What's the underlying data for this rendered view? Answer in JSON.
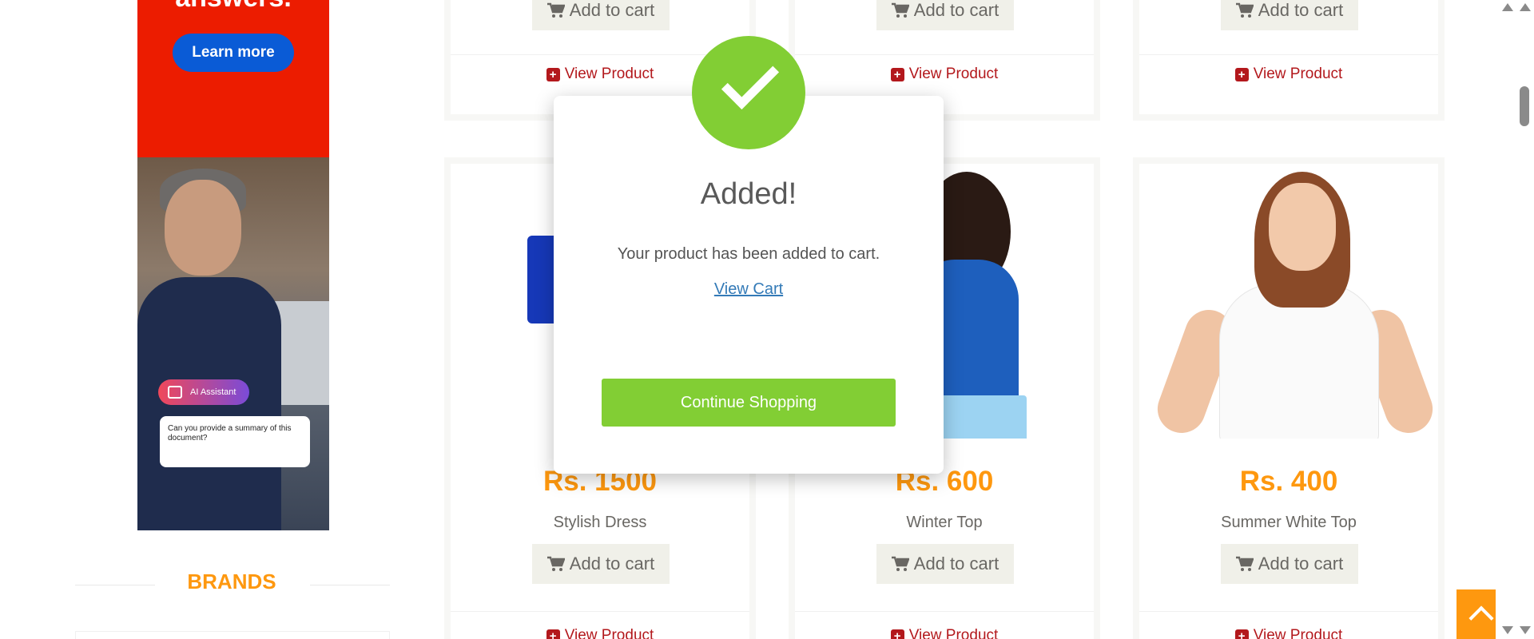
{
  "ad": {
    "headline": "answers.",
    "button_label": "Learn more",
    "chip_label": "AI Assistant",
    "card_text": "Can you provide a summary of this document?"
  },
  "brands": {
    "title": "BRANDS"
  },
  "products_top": [
    {
      "add_to_cart": "Add to cart",
      "view_product": "View Product"
    },
    {
      "add_to_cart": "Add to cart",
      "view_product": "View Product"
    },
    {
      "add_to_cart": "Add to cart",
      "view_product": "View Product"
    }
  ],
  "products": [
    {
      "price": "Rs. 1500",
      "name": "Stylish Dress",
      "add_to_cart": "Add to cart",
      "view_product": "View Product"
    },
    {
      "price": "Rs. 600",
      "name": "Winter Top",
      "add_to_cart": "Add to cart",
      "view_product": "View Product"
    },
    {
      "price": "Rs. 400",
      "name": "Summer White Top",
      "add_to_cart": "Add to cart",
      "view_product": "View Product"
    }
  ],
  "modal": {
    "title": "Added!",
    "message": "Your product has been added to cart.",
    "link_label": "View Cart",
    "button_label": "Continue Shopping"
  },
  "colors": {
    "accent_orange": "#fe980f",
    "success_green": "#82ce34",
    "link_red": "#b3181c",
    "ad_red": "#ec1c00"
  },
  "icons": [
    "cart-icon",
    "plus-square-icon",
    "check-icon",
    "chevron-up-icon"
  ]
}
